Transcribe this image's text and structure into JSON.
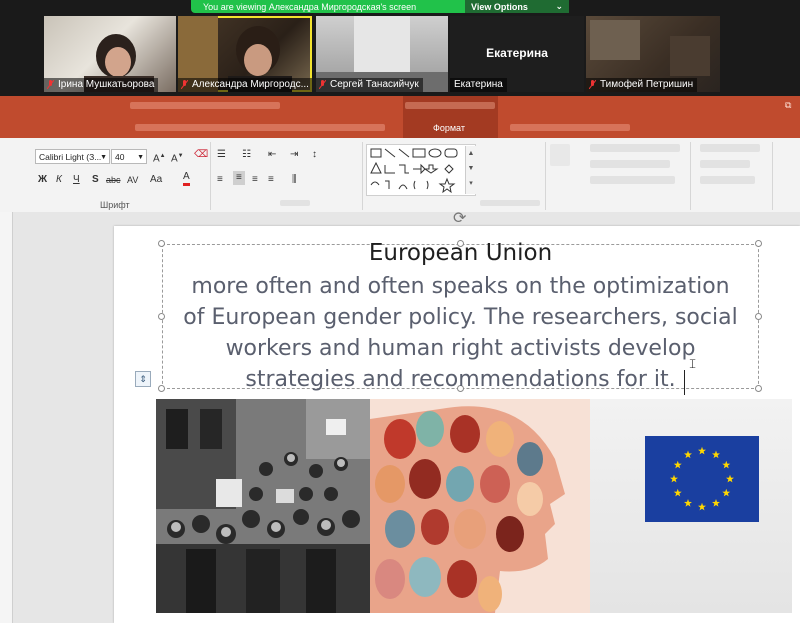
{
  "zoom": {
    "banner_text": "You are viewing Александра Миргородская's screen",
    "view_options_label": "View Options",
    "participants": [
      {
        "name": "Ірина Мушкатьорова",
        "muted": true
      },
      {
        "name": "Александра Миргородс...",
        "muted": true,
        "active": true
      },
      {
        "name": "Сергей Танасийчук",
        "muted": true
      },
      {
        "name": "Екатерина",
        "muted": false,
        "center_name": "Екатерина"
      },
      {
        "name": "Тимофей Петришин",
        "muted": true
      }
    ]
  },
  "ribbon": {
    "font_name": "Calibri Light (З...",
    "font_size": "40",
    "grow_font": "A",
    "shrink_font": "A",
    "bold": "Ж",
    "italic": "К",
    "underline": "Ч",
    "shadow": "S",
    "strike": "abc",
    "spacing": "AV",
    "case": "Aa",
    "font_color": "A",
    "font_group_label": "Шрифт",
    "format_tab": "Формат"
  },
  "slide": {
    "title": "European Union",
    "body_lines": [
      "more often and often speaks on the optimization",
      "of European gender policy. The researchers, social",
      "workers and human right activists develop",
      "strategies and recommendations for it."
    ]
  },
  "colors": {
    "ribbon": "#c04b2e",
    "zoom_green": "#21c24a",
    "eu_blue": "#1a3fa0",
    "eu_star": "#ffd700"
  }
}
